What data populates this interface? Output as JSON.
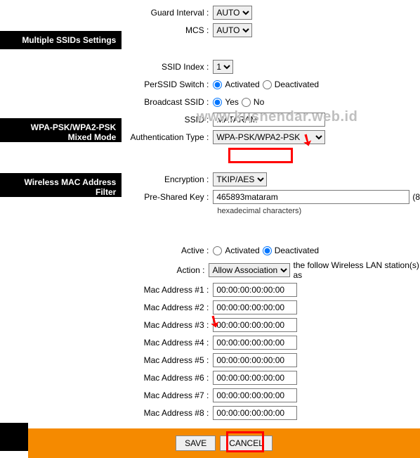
{
  "top": {
    "guard_interval_label": "Guard Interval :",
    "guard_interval_value": "AUTO",
    "mcs_label": "MCS :",
    "mcs_value": "AUTO"
  },
  "sections": {
    "ssids": "Multiple SSIDs Settings",
    "wpa": "WPA-PSK/WPA2-PSK Mixed Mode",
    "mac": "Wireless MAC Address Filter"
  },
  "ssid": {
    "index_label": "SSID Index :",
    "index_value": "1",
    "perssid_label": "PerSSID Switch :",
    "activated": "Activated",
    "deactivated": "Deactivated",
    "broadcast_label": "Broadcast SSID :",
    "yes": "Yes",
    "no": "No",
    "ssid_label": "SSID :",
    "ssid_value": "MATARAM",
    "auth_label": "Authentication Type :",
    "auth_value": "WPA-PSK/WPA2-PSK"
  },
  "wpa": {
    "encryption_label": "Encryption :",
    "encryption_value": "TKIP/AES",
    "psk_label": "Pre-Shared Key :",
    "psk_value": "465893mataram",
    "psk_note": "hexadecimal characters)",
    "psk_suffix": "(8"
  },
  "mac": {
    "active_label": "Active :",
    "activated": "Activated",
    "deactivated": "Deactivated",
    "action_label": "Action :",
    "action_value": "Allow Association",
    "action_suffix": "the follow Wireless LAN station(s) as",
    "addr_labels": [
      "Mac Address #1 :",
      "Mac Address #2 :",
      "Mac Address #3 :",
      "Mac Address #4 :",
      "Mac Address #5 :",
      "Mac Address #6 :",
      "Mac Address #7 :",
      "Mac Address #8 :"
    ],
    "addr_value": "00:00:00:00:00:00"
  },
  "footer": {
    "save": "SAVE",
    "cancel": "CANCEL"
  },
  "watermark": "www.kusnendar.web.id"
}
